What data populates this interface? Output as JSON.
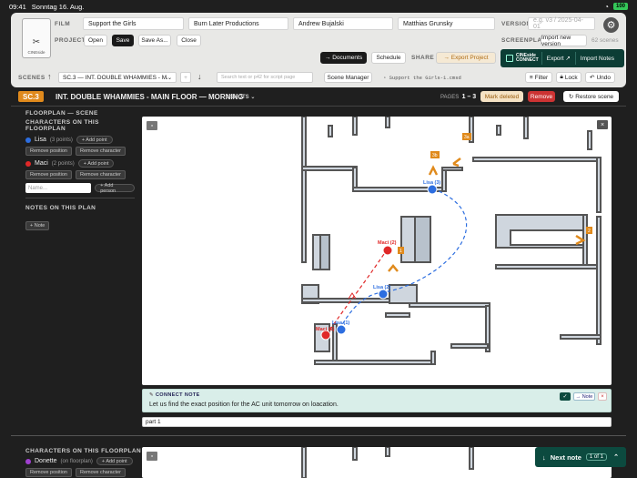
{
  "status": {
    "time": "09:41",
    "date": "Sonntag 16. Aug.",
    "battery": "100"
  },
  "film": {
    "label": "FILM",
    "fields": [
      "Support the Girls",
      "Burn Later Productions",
      "Andrew Bujalski",
      "Matthias Grunsky"
    ],
    "version_label": "VERSION",
    "version_placeholder": "e.g. v3 / 2025-04-01"
  },
  "logo": {
    "text": "CINEside"
  },
  "project": {
    "label": "PROJECT",
    "buttons": [
      "Open",
      "Save",
      "Save As...",
      "Close"
    ]
  },
  "share": {
    "label": "SHARE",
    "export_project": "→ Export Project"
  },
  "screenplay": {
    "label": "SCREENPLAY",
    "import_new": "Import new version",
    "count": "62 scenes"
  },
  "actions": {
    "documents": "→ Documents",
    "schedule": "Schedule"
  },
  "connect": {
    "logo_line1": "CINEside",
    "logo_line2": "CONNECT",
    "export": "Export ↗",
    "import_notes": "Import Notes"
  },
  "scenes_bar": {
    "label": "SCENES",
    "selected": "SC.3 — INT. DOUBLE WHAMMIES - MA...",
    "search_placeholder": "Search text or p42 for script page",
    "manager": "Scene Manager",
    "file": "Support the Girls-1.cmsd",
    "filter": "Filter",
    "lock": "Lock",
    "undo": "Undo"
  },
  "scene": {
    "badge": "SC.3",
    "title": "INT. DOUBLE WHAMMIES - MAIN FLOOR — MORNING",
    "shots": "0 SHOTS",
    "pages_label": "PAGES",
    "pages_value": "1 – 3",
    "mark_deleted": "Mark deleted",
    "remove": "Remove",
    "restore": "Restore scene"
  },
  "sidebar1": {
    "section": "FLOORPLAN — SCENE",
    "chars_title": "CHARACTERS ON THIS FLOORPLAN",
    "characters": [
      {
        "name": "Lisa",
        "points": "(3 points)",
        "color": "#2d6ee0"
      },
      {
        "name": "Maci",
        "points": "(2 points)",
        "color": "#e02828"
      }
    ],
    "add_point": "+ Add point",
    "remove_position": "Remove position",
    "remove_character": "Remove character",
    "name_placeholder": "Name...",
    "add_person": "+ Add person",
    "notes_title": "NOTES ON THIS PLAN",
    "add_note": "+ Note"
  },
  "map": {
    "markers": [
      {
        "label": "Lisa (3)",
        "color": "#2d6ee0"
      },
      {
        "label": "Lisa (2)",
        "color": "#2d6ee0"
      },
      {
        "label": "Lisa (1)",
        "color": "#2d6ee0"
      },
      {
        "label": "Maci (2)",
        "color": "#e02828"
      },
      {
        "label": "Maci (1)",
        "color": "#e02828"
      }
    ],
    "camera_tags": [
      "3a",
      "3b",
      "1",
      "2"
    ]
  },
  "note": {
    "label": "CONNECT NOTE",
    "text": "Let us find the exact position for the AC unit tomorrow on loacation.",
    "note_btn": "→ Note",
    "check": "✓",
    "close": "×"
  },
  "part": {
    "value": "part 1"
  },
  "sidebar2": {
    "chars_title": "CHARACTERS ON THIS FLOORPLAN",
    "character": {
      "name": "Donette",
      "status": "(on floorplan)",
      "color": "#a040d0"
    },
    "add_point": "+ Add point",
    "remove_position": "Remove position",
    "remove_character": "Remove character"
  },
  "next_note": {
    "label": "Next note",
    "count": "1 of 1"
  }
}
